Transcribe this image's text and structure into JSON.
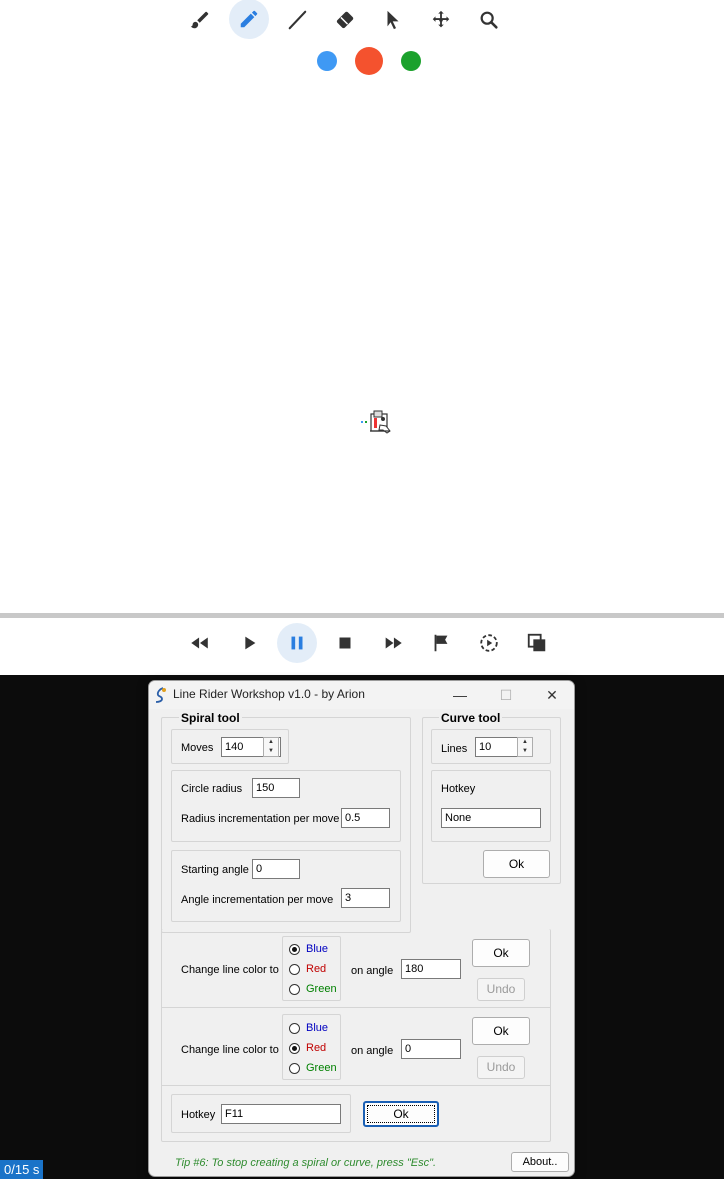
{
  "toolbar": {
    "tools": [
      {
        "name": "brush",
        "icon": "brush-icon",
        "active": false
      },
      {
        "name": "pencil",
        "icon": "pencil-icon",
        "active": true
      },
      {
        "name": "line",
        "icon": "line-icon",
        "active": false
      },
      {
        "name": "eraser",
        "icon": "eraser-icon",
        "active": false
      },
      {
        "name": "select",
        "icon": "cursor-icon",
        "active": false
      },
      {
        "name": "pan",
        "icon": "move-icon",
        "active": false
      },
      {
        "name": "zoom",
        "icon": "magnifier-icon",
        "active": false
      }
    ],
    "colors": [
      {
        "name": "blue",
        "hex": "#3f99f4",
        "selected": false
      },
      {
        "name": "red",
        "hex": "#f4522e",
        "selected": true
      },
      {
        "name": "green",
        "hex": "#1ba12c",
        "selected": false
      }
    ]
  },
  "playback": {
    "buttons": [
      {
        "name": "rewind",
        "icon": "rewind-icon"
      },
      {
        "name": "play",
        "icon": "play-icon"
      },
      {
        "name": "pause",
        "icon": "pause-icon",
        "active": true
      },
      {
        "name": "stop",
        "icon": "stop-icon"
      },
      {
        "name": "fast-forward",
        "icon": "fast-forward-icon"
      },
      {
        "name": "flag",
        "icon": "flag-icon"
      },
      {
        "name": "camera-mode",
        "icon": "timer-play-icon"
      },
      {
        "name": "layers",
        "icon": "layers-icon"
      }
    ]
  },
  "status": {
    "time": "0/15 s"
  },
  "dialog": {
    "title": "Line Rider Workshop v1.0 - by Arion",
    "controls": {
      "minimize": "—",
      "maximize": "☐",
      "close": "✕"
    },
    "spiral": {
      "title": "Spiral tool",
      "moves_label": "Moves",
      "moves_value": "140",
      "circle_radius_label": "Circle radius",
      "circle_radius_value": "150",
      "radius_increment_label": "Radius incrementation per move",
      "radius_increment_value": "0.5",
      "starting_angle_label": "Starting angle",
      "starting_angle_value": "0",
      "angle_increment_label": "Angle incrementation per move",
      "angle_increment_value": "3"
    },
    "curve": {
      "title": "Curve tool",
      "lines_label": "Lines",
      "lines_value": "10",
      "hotkey_label": "Hotkey",
      "hotkey_value": "None",
      "ok_label": "Ok"
    },
    "color_change_1": {
      "label": "Change line color to",
      "options": [
        {
          "label": "Blue",
          "color": "#0000c0",
          "checked": true
        },
        {
          "label": "Red",
          "color": "#c00000",
          "checked": false
        },
        {
          "label": "Green",
          "color": "#008000",
          "checked": false
        }
      ],
      "angle_label": "on angle",
      "angle_value": "180",
      "ok_label": "Ok",
      "undo_label": "Undo"
    },
    "color_change_2": {
      "label": "Change line color to",
      "options": [
        {
          "label": "Blue",
          "color": "#0000c0",
          "checked": false
        },
        {
          "label": "Red",
          "color": "#c00000",
          "checked": true
        },
        {
          "label": "Green",
          "color": "#008000",
          "checked": false
        }
      ],
      "angle_label": "on angle",
      "angle_value": "0",
      "ok_label": "Ok",
      "undo_label": "Undo"
    },
    "hotkey": {
      "label": "Hotkey",
      "value": "F11",
      "ok_label": "Ok"
    },
    "tip": "Tip #6: To stop creating a spiral or curve, press \"Esc\".",
    "about_label": "About.."
  }
}
